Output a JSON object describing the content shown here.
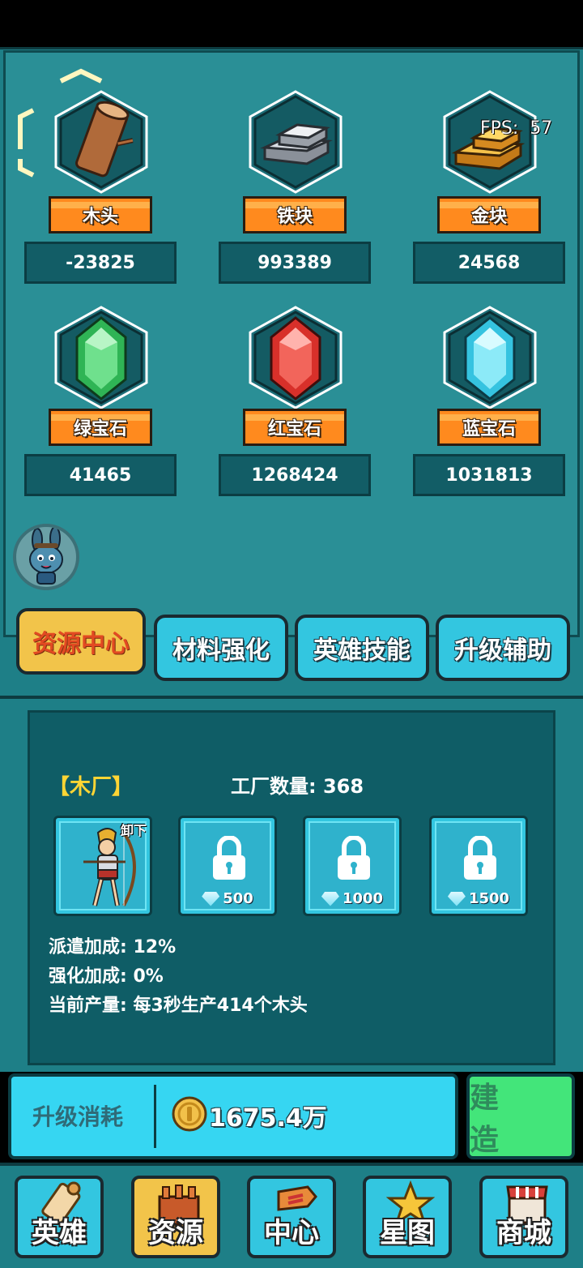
{
  "fps": {
    "label": "FPS:",
    "value": "57"
  },
  "resources": [
    {
      "name": "木头",
      "value": "-23825",
      "icon": "wood-log-icon",
      "color": "#b06a3a"
    },
    {
      "name": "铁块",
      "value": "993389",
      "icon": "iron-ingot-icon",
      "color": "#c9ced6"
    },
    {
      "name": "金块",
      "value": "24568",
      "icon": "gold-ingot-icon",
      "color": "#f2b43a"
    },
    {
      "name": "绿宝石",
      "value": "41465",
      "icon": "emerald-icon",
      "color": "#3ecf6a"
    },
    {
      "name": "红宝石",
      "value": "1268424",
      "icon": "ruby-icon",
      "color": "#e8433a"
    },
    {
      "name": "蓝宝石",
      "value": "1031813",
      "icon": "sapphire-icon",
      "color": "#6be3f5"
    }
  ],
  "tabs": [
    {
      "label": "资源中心",
      "active": true
    },
    {
      "label": "材料强化",
      "active": false
    },
    {
      "label": "英雄技能",
      "active": false
    },
    {
      "label": "升级辅助",
      "active": false
    }
  ],
  "factory": {
    "title": "【木厂】",
    "count_label": "工厂数量:",
    "count": "368",
    "slots": [
      {
        "type": "hero",
        "action": "卸下"
      },
      {
        "type": "locked",
        "cost": "500"
      },
      {
        "type": "locked",
        "cost": "1000"
      },
      {
        "type": "locked",
        "cost": "1500"
      }
    ],
    "stats": [
      {
        "label": "派遣加成:",
        "value": "12%"
      },
      {
        "label": "强化加成:",
        "value": "0%"
      },
      {
        "label": "当前产量:",
        "value": "每3秒生产414个木头"
      }
    ]
  },
  "upgrade": {
    "label": "升级消耗",
    "value": "1675.4万",
    "build_label": "建 造"
  },
  "nav": [
    {
      "label": "英雄",
      "icon": "scroll-icon",
      "active": false
    },
    {
      "label": "资源",
      "icon": "crate-icon",
      "active": true
    },
    {
      "label": "中心",
      "icon": "signpost-icon",
      "active": false
    },
    {
      "label": "星图",
      "icon": "star-icon",
      "active": false
    },
    {
      "label": "商城",
      "icon": "shop-icon",
      "active": false
    }
  ]
}
